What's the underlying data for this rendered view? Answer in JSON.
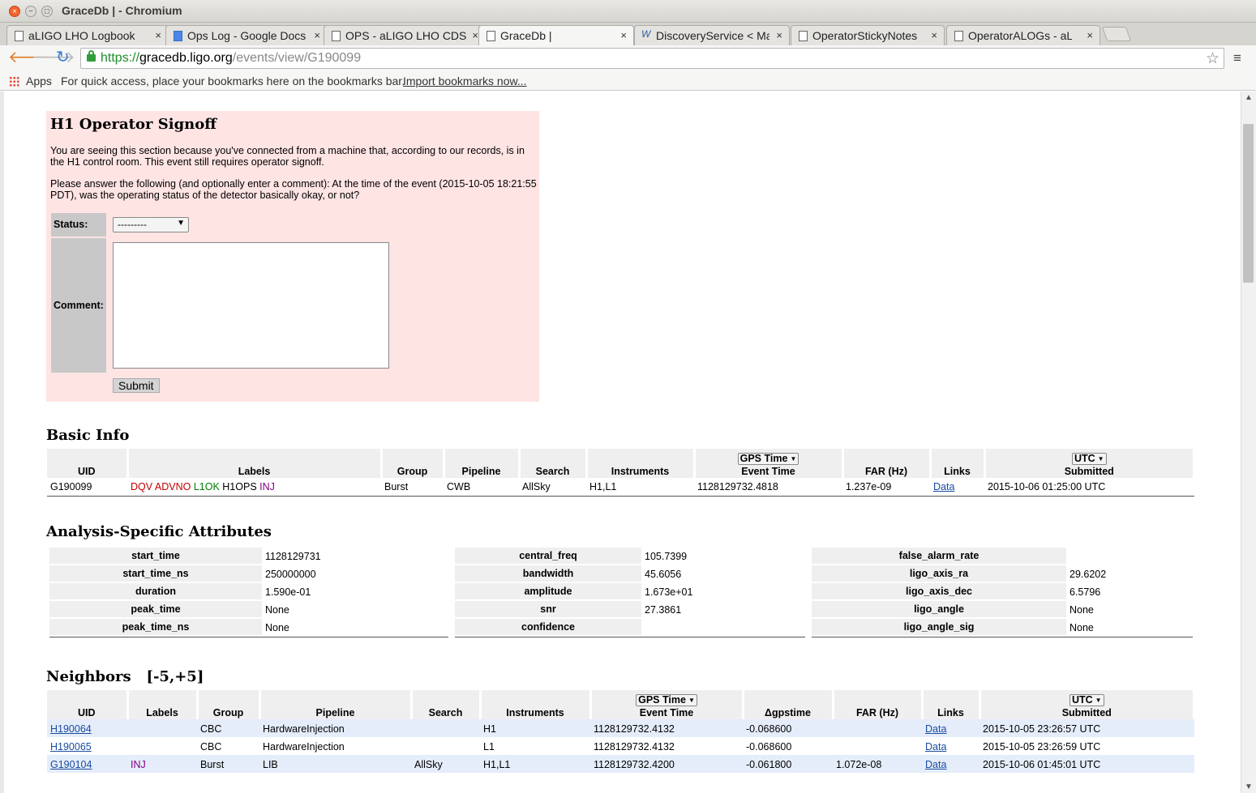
{
  "window": {
    "title": "GraceDb | - Chromium",
    "close_symbol": "×",
    "min_symbol": "−",
    "max_symbol": "□"
  },
  "tabs": [
    {
      "label": "aLIGO LHO Logbook",
      "icon": "page-icon",
      "close": "×"
    },
    {
      "label": "Ops Log - Google Docs",
      "icon": "google-docs-icon",
      "close": "×"
    },
    {
      "label": "OPS - aLIGO LHO CDS",
      "icon": "page-icon",
      "close": "×"
    },
    {
      "label": "GraceDb |",
      "icon": "page-icon",
      "close": "×"
    },
    {
      "label": "DiscoveryService < Ma",
      "icon": "wiki-icon",
      "icon_text": "W",
      "close": "×"
    },
    {
      "label": "OperatorStickyNotes",
      "icon": "page-icon",
      "close": "×"
    },
    {
      "label": "OperatorALOGs - aLIGO",
      "icon": "page-icon",
      "close": "×"
    }
  ],
  "toolbar": {
    "back": "🡐",
    "forward": "🡒",
    "reload": "↻",
    "url_scheme": "https://",
    "url_host": "gracedb.ligo.org",
    "url_path": "/events/view/G190099",
    "star": "☆",
    "menu": "≡"
  },
  "bookmarks": {
    "apps_label": "Apps",
    "hint": "For quick access, place your bookmarks here on the bookmarks bar.",
    "import_link": "Import bookmarks now..."
  },
  "signoff": {
    "title": "H1 Operator Signoff",
    "para1": "You are seeing this section because you've connected from a machine that, according to our records, is in the H1 control room. This event still requires operator signoff.",
    "para2": "Please answer the following (and optionally enter a comment): At the time of the event (2015-10-05 18:21:55 PDT), was the operating status of the detector basically okay, or not?",
    "status_label": "Status:",
    "status_value": "---------",
    "comment_label": "Comment:",
    "comment_value": "",
    "submit_label": "Submit"
  },
  "basic_info": {
    "heading": "Basic Info",
    "headers": {
      "uid": "UID",
      "labels": "Labels",
      "group": "Group",
      "pipeline": "Pipeline",
      "search": "Search",
      "instruments": "Instruments",
      "gps_dropdown": "GPS Time",
      "event_time": "Event Time",
      "far": "FAR (Hz)",
      "links": "Links",
      "utc_dropdown": "UTC",
      "submitted": "Submitted"
    },
    "row": {
      "uid": "G190099",
      "labels": [
        {
          "text": "DQV",
          "color": "#c00000"
        },
        {
          "text": "ADVNO",
          "color": "#c00000"
        },
        {
          "text": "L1OK",
          "color": "#008000"
        },
        {
          "text": "H1OPS",
          "color": "#000000"
        },
        {
          "text": "INJ",
          "color": "#800080"
        }
      ],
      "group": "Burst",
      "pipeline": "CWB",
      "search": "AllSky",
      "instruments": "H1,L1",
      "event_time": "1128129732.4818",
      "far": "1.237e-09",
      "link": "Data",
      "submitted": "2015-10-06 01:25:00 UTC"
    }
  },
  "attributes": {
    "heading": "Analysis-Specific Attributes",
    "col_a": [
      {
        "key": "start_time",
        "value": "1128129731"
      },
      {
        "key": "start_time_ns",
        "value": "250000000"
      },
      {
        "key": "duration",
        "value": "1.590e-01"
      },
      {
        "key": "peak_time",
        "value": "None"
      },
      {
        "key": "peak_time_ns",
        "value": "None"
      }
    ],
    "col_b": [
      {
        "key": "central_freq",
        "value": "105.7399"
      },
      {
        "key": "bandwidth",
        "value": "45.6056"
      },
      {
        "key": "amplitude",
        "value": "1.673e+01"
      },
      {
        "key": "snr",
        "value": "27.3861"
      },
      {
        "key": "confidence",
        "value": ""
      }
    ],
    "col_c": [
      {
        "key": "false_alarm_rate",
        "value": ""
      },
      {
        "key": "ligo_axis_ra",
        "value": "29.6202"
      },
      {
        "key": "ligo_axis_dec",
        "value": "6.5796"
      },
      {
        "key": "ligo_angle",
        "value": "None"
      },
      {
        "key": "ligo_angle_sig",
        "value": "None"
      }
    ]
  },
  "neighbors": {
    "heading": "Neighbors",
    "window": "[-5,+5]",
    "headers": {
      "uid": "UID",
      "labels": "Labels",
      "group": "Group",
      "pipeline": "Pipeline",
      "search": "Search",
      "instruments": "Instruments",
      "gps_dropdown": "GPS Time",
      "event_time": "Event Time",
      "dgps": "Δgpstime",
      "far": "FAR (Hz)",
      "links": "Links",
      "utc_dropdown": "UTC",
      "submitted": "Submitted"
    },
    "rows": [
      {
        "uid": "H190064",
        "labels": "",
        "group": "CBC",
        "pipeline": "HardwareInjection",
        "search": "",
        "instruments": "H1",
        "event_time": "1128129732.4132",
        "dgps": "-0.068600",
        "far": "",
        "link": "Data",
        "submitted": "2015-10-05 23:26:57 UTC"
      },
      {
        "uid": "H190065",
        "labels": "",
        "group": "CBC",
        "pipeline": "HardwareInjection",
        "search": "",
        "instruments": "L1",
        "event_time": "1128129732.4132",
        "dgps": "-0.068600",
        "far": "",
        "link": "Data",
        "submitted": "2015-10-05 23:26:59 UTC"
      },
      {
        "uid": "G190104",
        "labels": "INJ",
        "group": "Burst",
        "pipeline": "LIB",
        "search": "AllSky",
        "instruments": "H1,L1",
        "event_time": "1128129732.4200",
        "dgps": "-0.061800",
        "far": "1.072e-08",
        "link": "Data",
        "submitted": "2015-10-06 01:45:01 UTC"
      }
    ]
  },
  "colors": {
    "signoff_bg": "#ffe4e4",
    "header_bg": "#efefef",
    "alt_row_bg": "#e5edfa",
    "link": "#1a4ca0"
  }
}
